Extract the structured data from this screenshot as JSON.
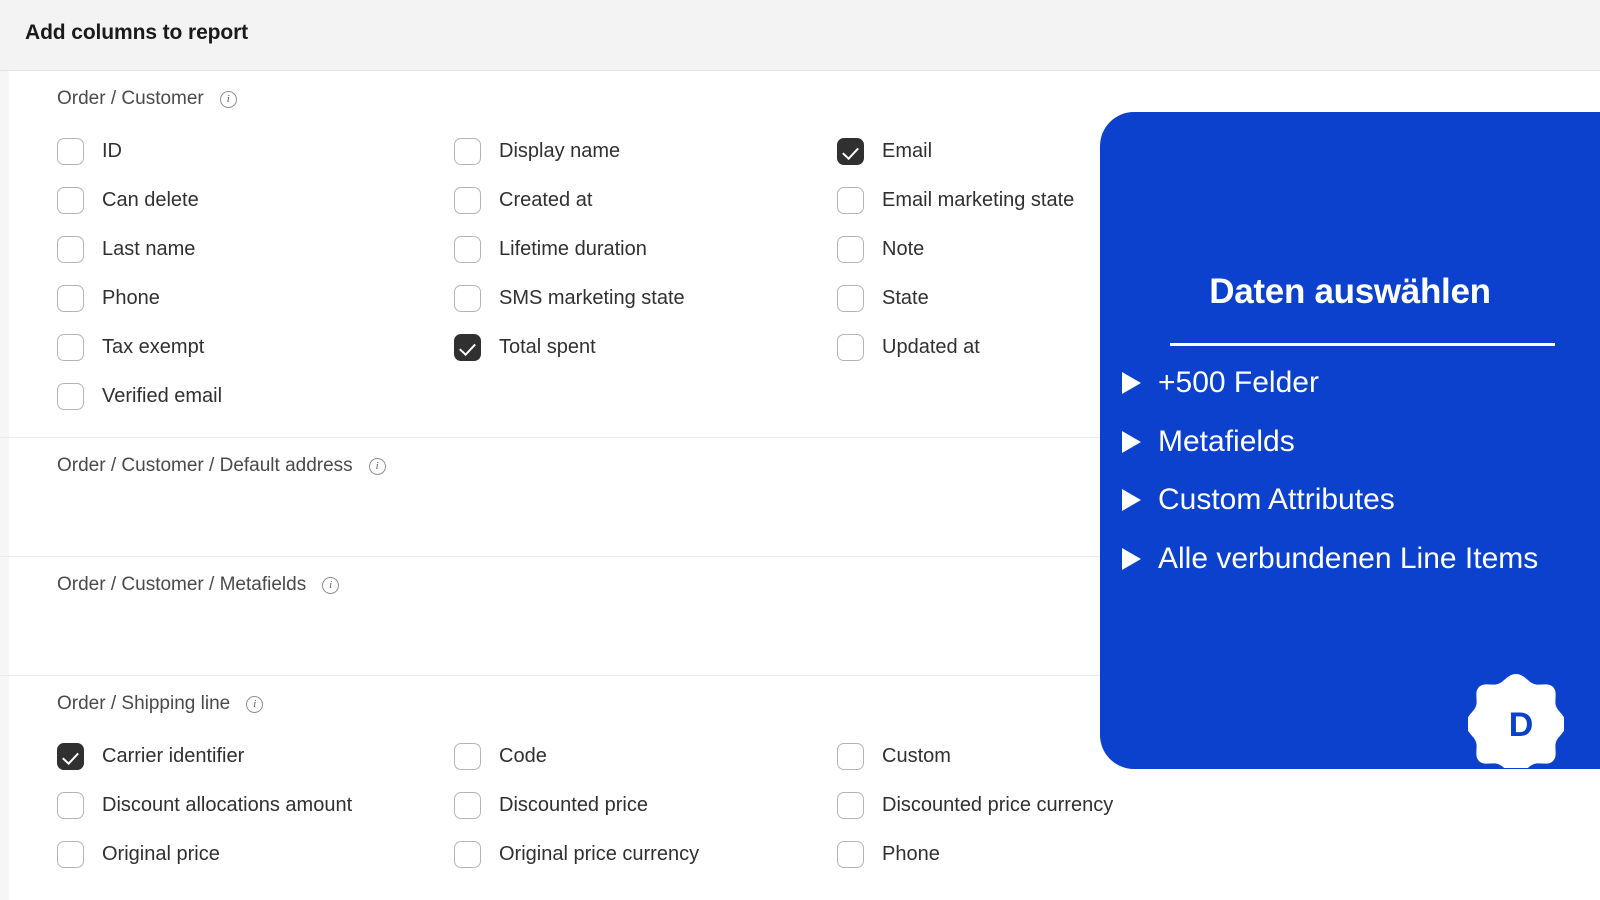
{
  "header": {
    "title": "Add columns to report"
  },
  "icons": {
    "info": "i",
    "info_name": "info-icon",
    "triangle_name": "play-triangle-icon",
    "logo_letter": "D"
  },
  "colors": {
    "promo_background": "#0b41cd",
    "checkbox_checked": "#303030",
    "header_background": "#f3f3f3",
    "text": "#303030"
  },
  "groups": [
    {
      "title": "Order / Customer",
      "columns": [
        [
          {
            "label": "ID",
            "checked": false
          },
          {
            "label": "Can delete",
            "checked": false
          },
          {
            "label": "Last name",
            "checked": false
          },
          {
            "label": "Phone",
            "checked": false
          },
          {
            "label": "Tax exempt",
            "checked": false
          },
          {
            "label": "Verified email",
            "checked": false
          }
        ],
        [
          {
            "label": "Display name",
            "checked": false
          },
          {
            "label": "Created at",
            "checked": false
          },
          {
            "label": "Lifetime duration",
            "checked": false
          },
          {
            "label": "SMS marketing state",
            "checked": false
          },
          {
            "label": "Total spent",
            "checked": true
          }
        ],
        [
          {
            "label": "Email",
            "checked": true
          },
          {
            "label": "Email marketing state",
            "checked": false
          },
          {
            "label": "Note",
            "checked": false
          },
          {
            "label": "State",
            "checked": false
          },
          {
            "label": "Updated at",
            "checked": false
          }
        ]
      ]
    },
    {
      "title": "Order / Customer / Default address",
      "columns": [
        [],
        [],
        []
      ]
    },
    {
      "title": "Order / Customer / Metafields",
      "columns": [
        [],
        [],
        []
      ]
    },
    {
      "title": "Order / Shipping line",
      "columns": [
        [
          {
            "label": "Carrier identifier",
            "checked": true
          },
          {
            "label": "Discount allocations amount",
            "checked": false
          },
          {
            "label": "Original price",
            "checked": false
          }
        ],
        [
          {
            "label": "Code",
            "checked": false
          },
          {
            "label": "Discounted price",
            "checked": false
          },
          {
            "label": "Original price currency",
            "checked": false
          }
        ],
        [
          {
            "label": "Custom",
            "checked": false
          },
          {
            "label": "Discounted price currency",
            "checked": false
          },
          {
            "label": "Phone",
            "checked": false
          }
        ]
      ]
    }
  ],
  "promo": {
    "title": "Daten auswählen",
    "items": [
      "+500 Felder",
      "Metafields",
      "Custom Attributes",
      "Alle verbundenen Line Items"
    ],
    "logo_letter": "D"
  }
}
